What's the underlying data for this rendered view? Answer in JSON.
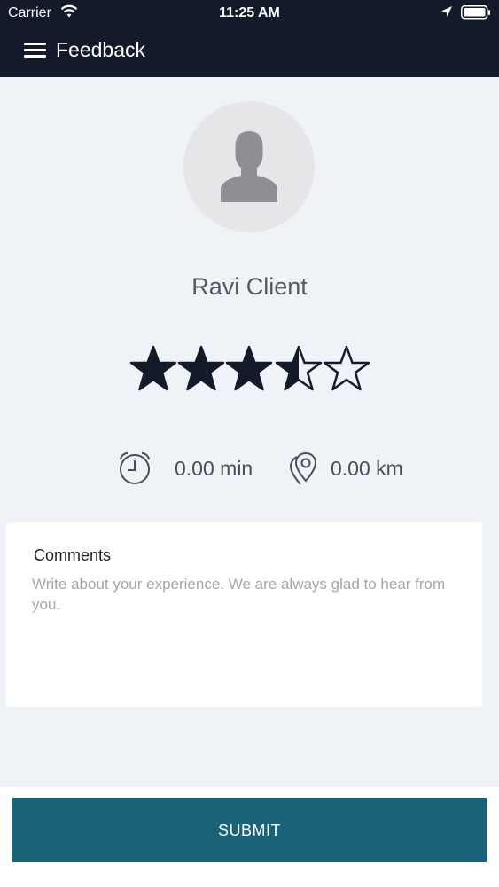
{
  "status_bar": {
    "carrier": "Carrier",
    "time": "11:25 AM",
    "icons": [
      "wifi-icon",
      "location-arrow-icon",
      "battery-icon"
    ]
  },
  "header": {
    "title": "Feedback",
    "menu_icon": "hamburger-menu-icon"
  },
  "profile": {
    "avatar_icon": "person-silhouette-icon",
    "name": "Ravi Client"
  },
  "rating": {
    "value": 3.5,
    "max": 5,
    "icon": "star-icon"
  },
  "trip_stats": {
    "duration": "0.00 min",
    "duration_icon": "alarm-clock-icon",
    "distance": "0.00 km",
    "distance_icon": "map-pin-icon"
  },
  "comments": {
    "label": "Comments",
    "value": "",
    "placeholder": "Write about your experience. We are always glad to hear from you."
  },
  "submit": {
    "label": "SUBMIT"
  },
  "colors": {
    "header_bg": "#131a2a",
    "page_bg": "#eff2f7",
    "star_color": "#131a2a",
    "submit_bg": "#1a6277"
  }
}
